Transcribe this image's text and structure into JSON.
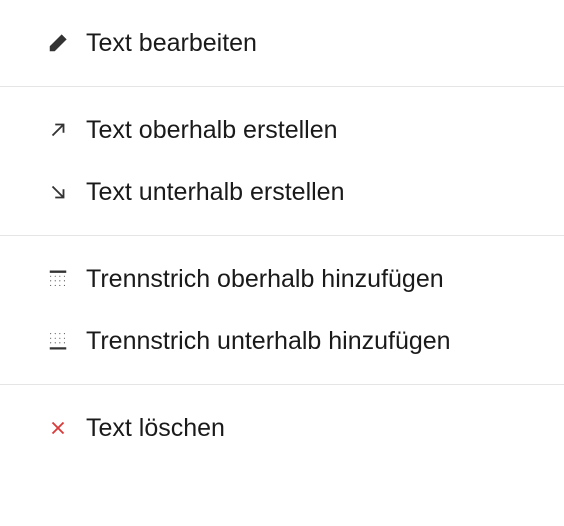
{
  "menu": {
    "edit_label": "Text bearbeiten",
    "create_above_label": "Text oberhalb erstellen",
    "create_below_label": "Text unterhalb erstellen",
    "separator_above_label": "Trennstrich oberhalb hinzufügen",
    "separator_below_label": "Trennstrich unterhalb hinzufügen",
    "delete_label": "Text löschen"
  },
  "colors": {
    "danger": "#d93a3a",
    "text": "#1a1a1a",
    "divider": "#e5e5e5"
  }
}
